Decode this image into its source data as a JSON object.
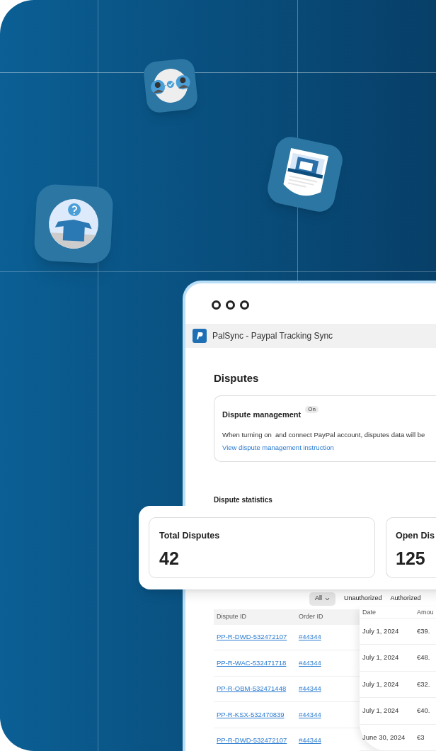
{
  "app": {
    "title": "PalSync - Paypal Tracking Sync"
  },
  "page_title": "Disputes",
  "management": {
    "title": "Dispute management",
    "toggle": {
      "label": "On",
      "on": true
    },
    "description": "When turning on  and connect PayPal account, disputes data will be",
    "link": "View dispute management instruction"
  },
  "statistics_title": "Dispute statistics",
  "stats": [
    {
      "label": "Total Disputes",
      "value": "42"
    },
    {
      "label": "Open Dis",
      "value": "125"
    }
  ],
  "filters": [
    {
      "label": "All",
      "selected": true,
      "dropdown": true
    },
    {
      "label": "Unauthorized",
      "selected": false,
      "dropdown": false
    },
    {
      "label": "Authorized",
      "selected": false,
      "dropdown": false
    }
  ],
  "table": {
    "columns": [
      "Dispute ID",
      "Order ID"
    ],
    "rows": [
      [
        "PP-R-DWD-532472107",
        "#44344"
      ],
      [
        "PP-R-WAC-532471718",
        "#44344"
      ],
      [
        "PP-R-OBM-532471448",
        "#44344"
      ],
      [
        "PP-R-KSX-532470839",
        "#44344"
      ],
      [
        "PP-R-DWD-532472107",
        "#44344"
      ]
    ]
  },
  "detail_table": {
    "columns": [
      "Date",
      "Amou"
    ],
    "rows": [
      [
        "July 1, 2024",
        "€39."
      ],
      [
        "July 1, 2024",
        "€48."
      ],
      [
        "July 1, 2024",
        "€32."
      ],
      [
        "July 1, 2024",
        "€40."
      ],
      [
        "June 30, 2024",
        "€3"
      ]
    ]
  }
}
